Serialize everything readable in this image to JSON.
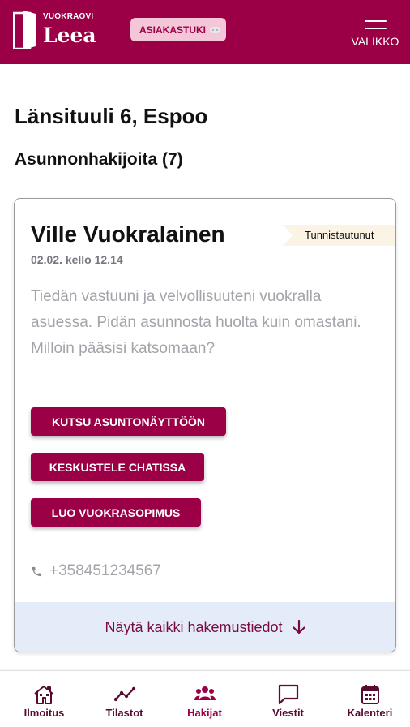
{
  "header": {
    "brand_small": "VUOKRAOVI",
    "brand_name": "Leea",
    "support_label": "ASIAKASTUKI",
    "menu_label": "VALIKKO"
  },
  "page": {
    "title": "Länsituuli 6, Espoo",
    "section_title": "Asunnonhakijoita (7)"
  },
  "applicant": {
    "name": "Ville Vuokralainen",
    "date": "02.02. kello 12.14",
    "badge": "Tunnistautunut",
    "message": "Tiedän vastuuni ja velvollisuuteni vuokralla asuessa. Pidän asunnosta huolta kuin omastani. Milloin pääsisi katsomaan?",
    "actions": [
      {
        "label": "KUTSU ASUNTONÄYTTÖÖN"
      },
      {
        "label": "KESKUSTELE CHATISSA"
      },
      {
        "label": "LUO VUOKRASOPIMUS"
      }
    ],
    "phone": "+358451234567",
    "show_all_label": "Näytä kaikki hakemustiedot"
  },
  "bottom_nav": {
    "items": [
      {
        "label": "Ilmoitus",
        "icon": "house-icon"
      },
      {
        "label": "Tilastot",
        "icon": "chart-line-icon"
      },
      {
        "label": "Hakijat",
        "icon": "people-icon",
        "active": true
      },
      {
        "label": "Viestit",
        "icon": "message-icon"
      },
      {
        "label": "Kalenteri",
        "icon": "calendar-icon"
      }
    ]
  },
  "colors": {
    "brand": "#9b0046",
    "support_bg": "#f3c6d8",
    "badge_bg": "#fbf3e4",
    "show_all_bg": "#e4ecfa",
    "muted_text": "#a3a3aa"
  }
}
